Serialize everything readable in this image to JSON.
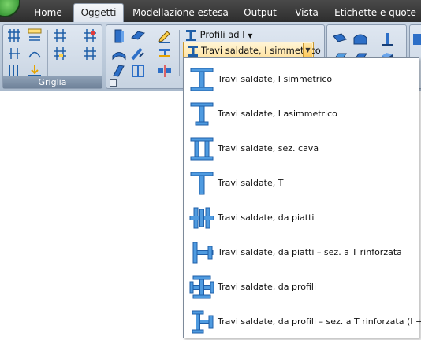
{
  "ribbon_tabs": [
    {
      "label": "Home"
    },
    {
      "label": "Oggetti"
    },
    {
      "label": "Modellazione estesa"
    },
    {
      "label": "Output"
    },
    {
      "label": "Vista"
    },
    {
      "label": "Etichette e quote"
    }
  ],
  "active_tab": "Oggetti",
  "groups": {
    "grid": {
      "label": "Griglia"
    }
  },
  "profiles": {
    "profiles_button_label": "Profili ad I",
    "selected_value": "Travi saldate, I simmetrico"
  },
  "menu": {
    "items": [
      {
        "label": "Travi saldate, I simmetrico",
        "icon": "i-beam-symmetric-icon"
      },
      {
        "label": "Travi saldate, I asimmetrico",
        "icon": "i-beam-asymmetric-icon"
      },
      {
        "label": "Travi saldate, sez. cava",
        "icon": "hollow-section-icon"
      },
      {
        "label": "Travi saldate, T",
        "icon": "t-section-icon"
      },
      {
        "label": "Travi saldate, da piatti",
        "icon": "plates-section-icon"
      },
      {
        "label": "Travi saldate, da piatti – sez. a T rinforzata",
        "icon": "plates-reinforced-t-icon"
      },
      {
        "label": "Travi saldate, da profili",
        "icon": "profiles-section-icon"
      },
      {
        "label": "Travi saldate, da profili – sez. a T rinforzata (I + T)",
        "icon": "profiles-reinforced-t-icon"
      }
    ]
  },
  "colors": {
    "icon_blue": "#4f9be0",
    "icon_dark": "#1f5fa8",
    "combo_highlight": "#ffe2a0"
  }
}
